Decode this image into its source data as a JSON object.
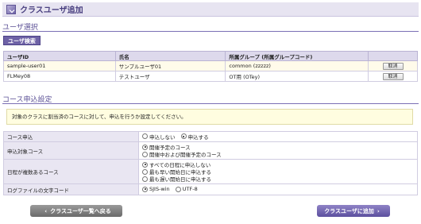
{
  "title": "クラスユーザ追加",
  "user_section": {
    "heading": "ユーザ選択",
    "search_button": "ユーザ検索",
    "columns": [
      "ユーザID",
      "氏名",
      "所属グループ (所属グループコード)",
      ""
    ],
    "rows": [
      {
        "id": "sample-user01",
        "name": "サンプルユーザ01",
        "group": "common (zzzzz)",
        "action": "取消"
      },
      {
        "id": "FLMey08",
        "name": "テストユーザ",
        "group": "OT用 (OTey)",
        "action": "取消"
      }
    ]
  },
  "course_section": {
    "heading": "コース申込設定",
    "notice": "対象のクラスに割当済のコースに対して、申込を行うか設定してください。",
    "settings": [
      {
        "label": "コース申込",
        "options": [
          {
            "text": "申込しない",
            "checked": false
          },
          {
            "text": "申込する",
            "checked": true
          }
        ]
      },
      {
        "label": "申込対象コース",
        "options": [
          {
            "text": "開催予定のコース",
            "checked": true
          },
          {
            "text": "開催中および開催予定のコース",
            "checked": false
          }
        ]
      },
      {
        "label": "日程が複数あるコース",
        "options": [
          {
            "text": "すべての日程に申込しない",
            "checked": true
          },
          {
            "text": "最も早い開始日に申込する",
            "checked": false
          },
          {
            "text": "最も遅い開始日に申込する",
            "checked": false
          }
        ]
      },
      {
        "label": "ログファイルの文字コード",
        "options": [
          {
            "text": "SJIS-win",
            "checked": true
          },
          {
            "text": "UTF-8",
            "checked": false
          }
        ]
      }
    ]
  },
  "footer": {
    "back_label": "クラスユーザ一覧へ戻る",
    "add_label": "クラスユーザに追加"
  }
}
